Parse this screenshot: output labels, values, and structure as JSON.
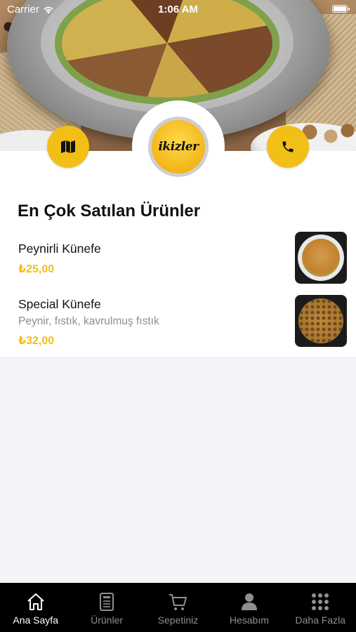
{
  "status_bar": {
    "carrier": "Carrier",
    "time": "1:06 AM"
  },
  "brand": {
    "logo_text": "ikizler",
    "accent_color": "#f2bf17"
  },
  "header": {
    "map_button_icon": "map-icon",
    "phone_button_icon": "phone-icon"
  },
  "section": {
    "title": "En Çok Satılan Ürünler"
  },
  "products": [
    {
      "name": "Peynirli Künefe",
      "description": "",
      "price": "₺25,00"
    },
    {
      "name": "Special Künefe",
      "description": "Peynir, fıstık, kavrulmuş fıstık",
      "price": "₺32,00"
    }
  ],
  "tabbar": {
    "items": [
      {
        "label": "Ana Sayfa",
        "icon": "home-icon",
        "active": true
      },
      {
        "label": "Ürünler",
        "icon": "menu-book-icon",
        "active": false
      },
      {
        "label": "Sepetiniz",
        "icon": "cart-icon",
        "active": false
      },
      {
        "label": "Hesabım",
        "icon": "person-icon",
        "active": false
      },
      {
        "label": "Daha Fazla",
        "icon": "grid-icon",
        "active": false
      }
    ]
  }
}
